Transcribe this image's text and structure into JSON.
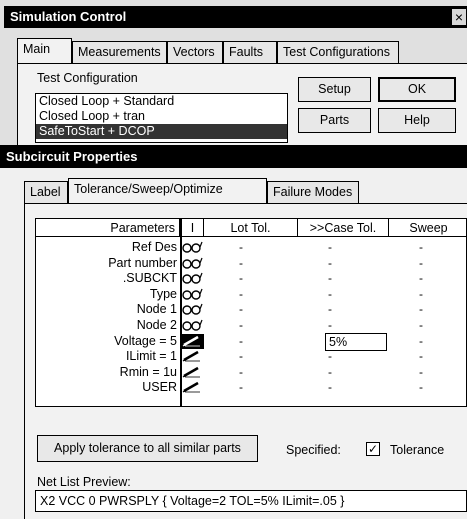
{
  "sim_window": {
    "title": "Simulation Control",
    "close_glyph": "×",
    "tabs": [
      "Main",
      "Measurements",
      "Vectors",
      "Faults",
      "Test Configurations"
    ],
    "active_tab": "Main",
    "test_config_label": "Test Configuration",
    "test_configs": [
      "Closed Loop + Standard",
      "Closed Loop + tran",
      "SafeToStart + DCOP"
    ],
    "selected_config": "SafeToStart + DCOP",
    "buttons": {
      "setup": "Setup",
      "ok": "OK",
      "parts": "Parts",
      "help": "Help"
    }
  },
  "sub_window": {
    "title": "Subcircuit Properties",
    "tabs": [
      "Label",
      "Tolerance/Sweep/Optimize",
      "Failure Modes"
    ],
    "active_tab": "Tolerance/Sweep/Optimize",
    "columns": {
      "parameters": "Parameters",
      "i": "I",
      "lot_tol": "Lot Tol.",
      "case_tol": ">>Case Tol.",
      "sweep": "Sweep"
    },
    "rows": [
      {
        "name": "Ref Des",
        "icon": "glasses-icon",
        "lot": "-",
        "case": "-",
        "sweep": "-"
      },
      {
        "name": "Part number",
        "icon": "glasses-icon",
        "lot": "-",
        "case": "-",
        "sweep": "-"
      },
      {
        "name": ".SUBCKT",
        "icon": "glasses-icon",
        "lot": "-",
        "case": "-",
        "sweep": "-"
      },
      {
        "name": "Type",
        "icon": "glasses-icon",
        "lot": "-",
        "case": "-",
        "sweep": "-"
      },
      {
        "name": "Node 1",
        "icon": "glasses-icon",
        "lot": "-",
        "case": "-",
        "sweep": "-"
      },
      {
        "name": "Node 2",
        "icon": "glasses-icon",
        "lot": "-",
        "case": "-",
        "sweep": "-"
      },
      {
        "name": "Voltage = 5",
        "icon": "pencil-icon",
        "lot": "-",
        "case": "5%",
        "sweep": "-"
      },
      {
        "name": "ILimit = 1",
        "icon": "pencil-icon",
        "lot": "-",
        "case": "-",
        "sweep": "-"
      },
      {
        "name": "Rmin = 1u",
        "icon": "pencil-icon",
        "lot": "-",
        "case": "-",
        "sweep": "-"
      },
      {
        "name": "USER",
        "icon": "pencil-icon",
        "lot": "-",
        "case": "-",
        "sweep": "-"
      }
    ],
    "apply_button": "Apply tolerance to all similar parts",
    "specified_label": "Specified:",
    "tolerance_checkbox": {
      "label": "Tolerance",
      "checked": true
    },
    "netlist_label": "Net List Preview:",
    "netlist_value": "X2 VCC 0 PWRSPLY { Voltage=2 TOL=5% ILimit=.05 }"
  }
}
